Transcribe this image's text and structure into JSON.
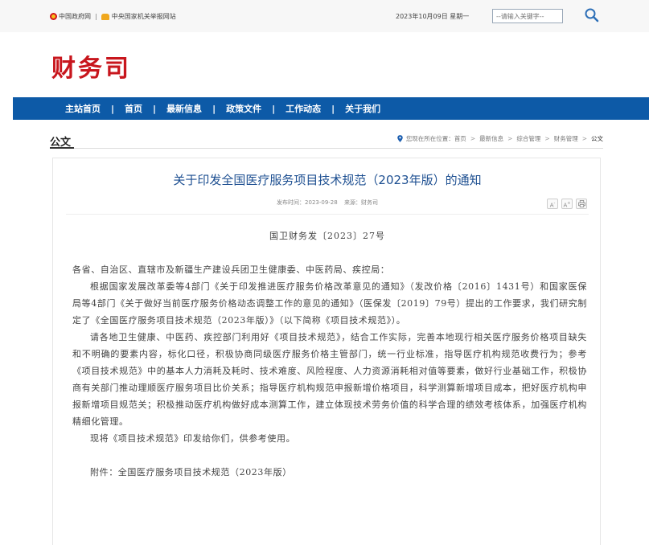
{
  "topbar": {
    "gov_link": "中国政府网",
    "separator": "|",
    "report_link": "中央国家机关举报网站",
    "date": "2023年10月09日 星期一",
    "search_placeholder": "--请输入关键字--"
  },
  "site": {
    "title": "财务司"
  },
  "nav": {
    "items": [
      {
        "label": "主站首页"
      },
      {
        "label": "首页"
      },
      {
        "label": "最新信息"
      },
      {
        "label": "政策文件"
      },
      {
        "label": "工作动态"
      },
      {
        "label": "关于我们"
      }
    ],
    "separator": "|"
  },
  "section": {
    "title": "公文"
  },
  "breadcrumb": {
    "prefix": "您现在所在位置：",
    "items": [
      "首页",
      "最新信息",
      "综合管理",
      "财务管理"
    ],
    "current": "公文",
    "separator": ">"
  },
  "article": {
    "title": "关于印发全国医疗服务项目技术规范（2023年版）的通知",
    "publish_time": "发布时间：2023-09-28",
    "source": "来源：财务司",
    "tools": {
      "font_smaller": "A-",
      "font_larger": "A+",
      "print": "print-icon"
    },
    "doc_number": "国卫财务发〔2023〕27号",
    "addressee": "各省、自治区、直辖市及新疆生产建设兵团卫生健康委、中医药局、疾控局：",
    "paragraphs": [
      "根据国家发展改革委等4部门《关于印发推进医疗服务价格改革意见的通知》（发改价格〔2016〕1431号）和国家医保局等4部门《关于做好当前医疗服务价格动态调整工作的意见的通知》（医保发〔2019〕79号）提出的工作要求，我们研究制定了《全国医疗服务项目技术规范（2023年版）》（以下简称《项目技术规范》）。",
      "请各地卫生健康、中医药、疾控部门利用好《项目技术规范》，结合工作实际，完善本地现行相关医疗服务价格项目缺失和不明确的要素内容，标化口径，积极协商同级医疗服务价格主管部门，统一行业标准，指导医疗机构规范收费行为；参考《项目技术规范》中的基本人力消耗及耗时、技术难度、风险程度、人力资源消耗相对值等要素，做好行业基础工作，积极协商有关部门推动理顺医疗服务项目比价关系；指导医疗机构规范申报新增价格项目，科学测算新增项目成本，把好医疗机构申报新增项目规范关；积极推动医疗机构做好成本测算工作，建立体现技术劳务价值的科学合理的绩效考核体系，加强医疗机构精细化管理。",
      "现将《项目技术规范》印发给你们，供参考使用。"
    ],
    "attachment": "附件：全国医疗服务项目技术规范（2023年版）"
  },
  "colors": {
    "brand_red": "#c8161d",
    "nav_blue": "#0d5aa7",
    "title_blue": "#1d4f91"
  }
}
